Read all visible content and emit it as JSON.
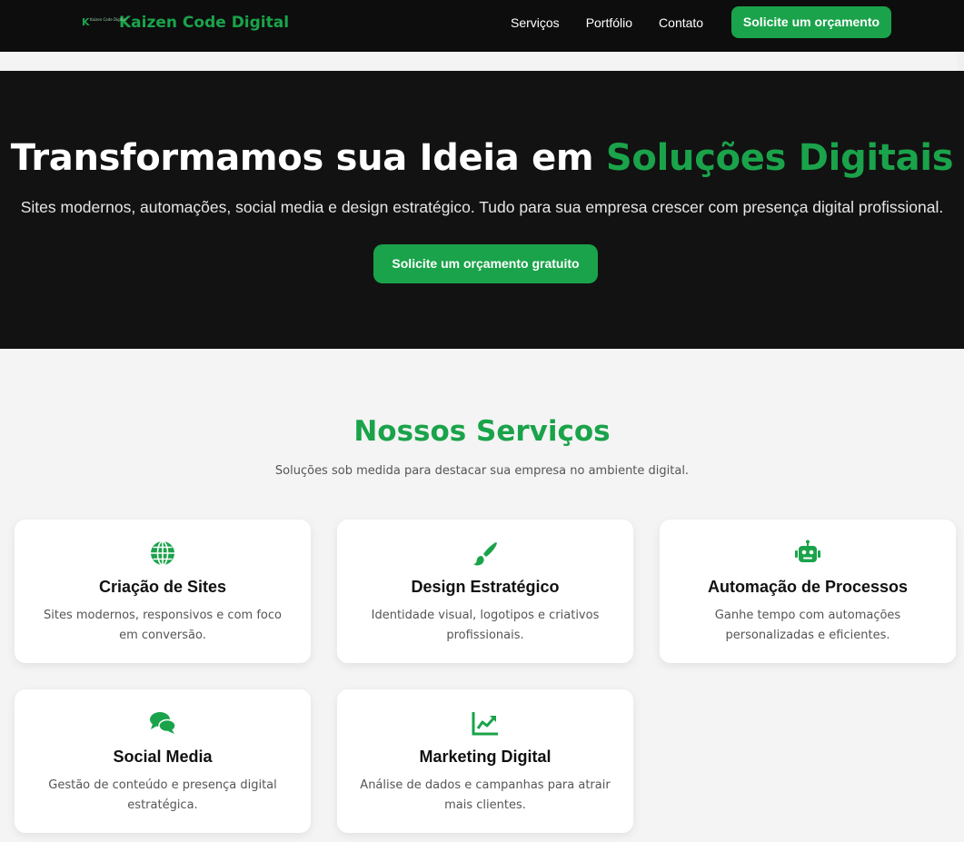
{
  "nav": {
    "logo_mark": "K",
    "logo_mini": "Kaizen Code Digital",
    "brand": "Kaizen Code Digital",
    "links": [
      "Serviços",
      "Portfólio",
      "Contato"
    ],
    "cta": "Solicite um orçamento"
  },
  "hero": {
    "title_white": "Transformamos sua Ideia em ",
    "title_green": "Soluções Digitais",
    "subtitle": "Sites modernos, automações, social media e design estratégico. Tudo para sua empresa crescer com presença digital profissional.",
    "cta": "Solicite um orçamento gratuito"
  },
  "services": {
    "title": "Nossos Serviços",
    "subtitle": "Soluções sob medida para destacar sua empresa no ambiente digital.",
    "cards": [
      {
        "icon": "globe-icon",
        "title": "Criação de Sites",
        "desc": "Sites modernos, responsivos e com foco em conversão."
      },
      {
        "icon": "paintbrush-icon",
        "title": "Design Estratégico",
        "desc": "Identidade visual, logotipos e criativos profissionais."
      },
      {
        "icon": "robot-icon",
        "title": "Automação de Processos",
        "desc": "Ganhe tempo com automações personalizadas e eficientes."
      },
      {
        "icon": "comments-icon",
        "title": "Social Media",
        "desc": "Gestão de conteúdo e presença digital estratégica."
      },
      {
        "icon": "chart-line-icon",
        "title": "Marketing Digital",
        "desc": "Análise de dados e campanhas para atrair mais clientes."
      }
    ]
  },
  "colors": {
    "accent": "#1aa34a",
    "navbar_bg": "#0d0d0d",
    "hero_bg": "#121212",
    "page_bg": "#f4f4f4"
  }
}
